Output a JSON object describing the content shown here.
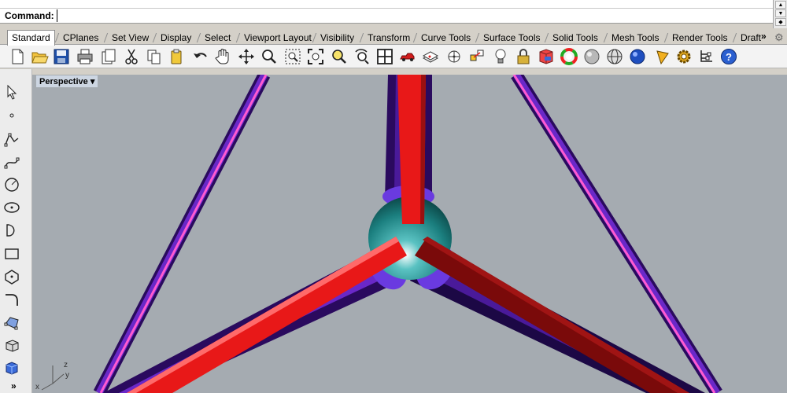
{
  "command": {
    "label": "Command:",
    "value": ""
  },
  "tabs": [
    "Standard",
    "CPlanes",
    "Set View",
    "Display",
    "Select",
    "Viewport Layout",
    "Visibility",
    "Transform",
    "Curve Tools",
    "Surface Tools",
    "Solid Tools",
    "Mesh Tools",
    "Render Tools",
    "Draft"
  ],
  "tabs_more": "»",
  "toolbar_icons": [
    "new-file",
    "open-folder",
    "save",
    "print",
    "import",
    "cut",
    "copy",
    "paste",
    "undo",
    "pan-hand",
    "rotate-view",
    "zoom",
    "zoom-window",
    "zoom-extents",
    "zoom-selected",
    "zoom-dynamic",
    "four-viewports",
    "car",
    "layers",
    "grid-snap",
    "osnap",
    "lightbulb",
    "lock",
    "layer-book",
    "color-wheel",
    "sphere-shaded",
    "sphere-wire",
    "sphere-render",
    "cone-tool",
    "gear-settings",
    "tree-hierarchy",
    "help"
  ],
  "side_tools": [
    "select-arrow",
    "point",
    "polyline",
    "curve",
    "circle",
    "ellipse",
    "arc",
    "rectangle",
    "polygon",
    "curve-fillet",
    "surface",
    "extrude",
    "box-solid"
  ],
  "side_more": "»",
  "viewport": {
    "title": "Perspective",
    "menu_glyph": "▾"
  },
  "axes": {
    "z": "z",
    "y": "y",
    "x": "x"
  },
  "colors": {
    "viewport_bg": "#a5abb1",
    "tube_purple": "#4a0f9a",
    "strut_red": "#e81818",
    "node_teal": "#1d8a8a"
  }
}
